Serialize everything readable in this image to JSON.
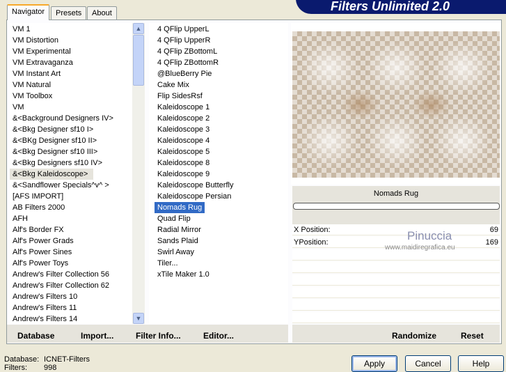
{
  "title": "Filters Unlimited 2.0",
  "tabs": [
    "Navigator",
    "Presets",
    "About"
  ],
  "categories": [
    "VM 1",
    "VM Distortion",
    "VM Experimental",
    "VM Extravaganza",
    "VM Instant Art",
    "VM Natural",
    "VM Toolbox",
    "VM",
    "&<Background Designers IV>",
    "&<Bkg Designer sf10 I>",
    "&<BKg Designer sf10 II>",
    "&<Bkg Designer sf10 III>",
    "&<Bkg Designers sf10 IV>",
    "&<Bkg Kaleidoscope>",
    "&<Sandflower Specials^v^ >",
    "[AFS IMPORT]",
    "AB Filters 2000",
    "AFH",
    "Alf's Border FX",
    "Alf's Power Grads",
    "Alf's Power Sines",
    "Alf's Power Toys",
    "Andrew's Filter Collection 56",
    "Andrew's Filter Collection 62",
    "Andrew's Filters 10",
    "Andrew's Filters 11",
    "Andrew's Filters 14"
  ],
  "selected_category_index": 13,
  "filters": [
    "4 QFlip UpperL",
    "4 QFlip UpperR",
    "4 QFlip ZBottomL",
    "4 QFlip ZBottomR",
    "@BlueBerry Pie",
    "Cake Mix",
    "Flip SidesRsf",
    "Kaleidoscope 1",
    "Kaleidoscope 2",
    "Kaleidoscope 3",
    "Kaleidoscope 4",
    "Kaleidoscope 5",
    "Kaleidoscope 8",
    "Kaleidoscope 9",
    "Kaleidoscope Butterfly",
    "Kaleidoscope Persian",
    "Nomads Rug",
    "Quad Flip",
    "Radial Mirror",
    "Sands Plaid",
    "Swirl Away",
    "Tiler...",
    "xTile Maker 1.0"
  ],
  "selected_filter_index": 16,
  "preview_filter_name": "Nomads Rug",
  "progress": 0,
  "params": [
    {
      "label": "X Position:",
      "value": "69"
    },
    {
      "label": "YPosition:",
      "value": "169"
    }
  ],
  "watermark": {
    "name": "Pinuccia",
    "url": "www.maidiregrafica.eu"
  },
  "left_buttons": [
    "Database",
    "Import...",
    "Filter Info...",
    "Editor..."
  ],
  "right_buttons": [
    "Randomize",
    "Reset"
  ],
  "status": {
    "database_label": "Database:",
    "database_value": "ICNET-Filters",
    "filters_label": "Filters:",
    "filters_value": "998"
  },
  "dialog_buttons": [
    "Apply",
    "Cancel",
    "Help"
  ]
}
